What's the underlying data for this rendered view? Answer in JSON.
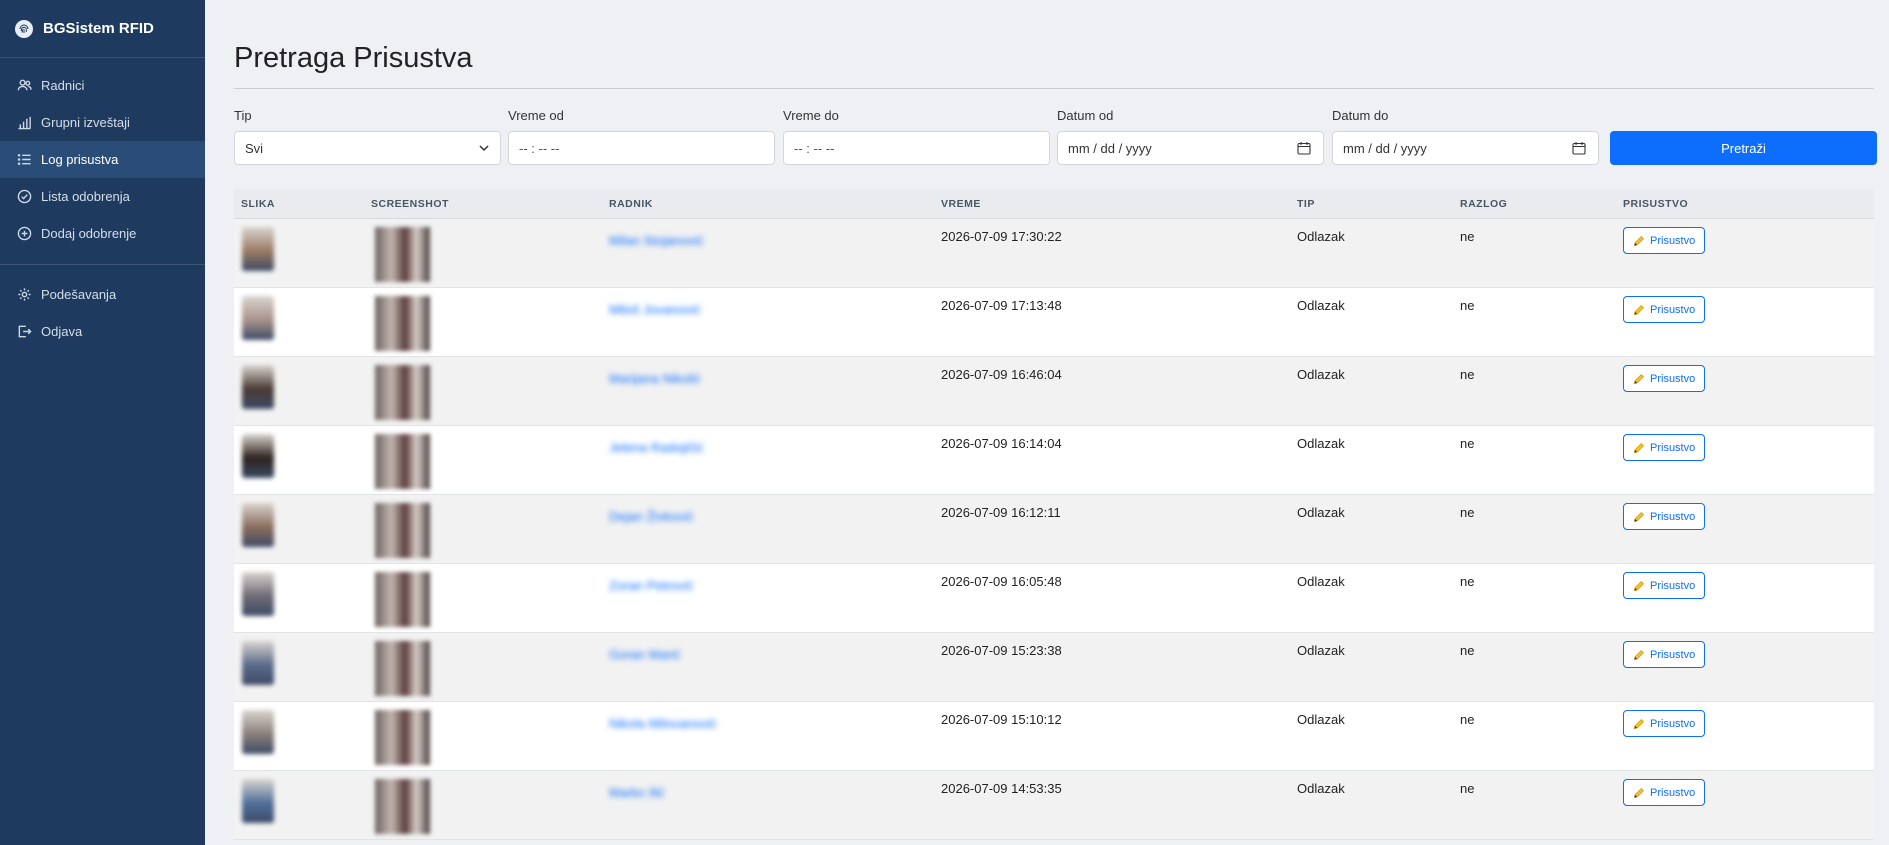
{
  "sidebar": {
    "brand": "BGSistem RFID",
    "items": [
      {
        "label": "Radnici",
        "icon": "users-icon"
      },
      {
        "label": "Grupni izveštaji",
        "icon": "bar-chart-icon"
      },
      {
        "label": "Log prisustva",
        "icon": "list-icon",
        "active": true
      },
      {
        "label": "Lista odobrenja",
        "icon": "check-circle-icon"
      },
      {
        "label": "Dodaj odobrenje",
        "icon": "plus-circle-icon"
      }
    ],
    "bottom_items": [
      {
        "label": "Podešavanja",
        "icon": "gear-icon"
      },
      {
        "label": "Odjava",
        "icon": "logout-icon"
      }
    ]
  },
  "page": {
    "title": "Pretraga Prisustva"
  },
  "filters": {
    "tip_label": "Tip",
    "tip_value": "Svi",
    "vreme_od_label": "Vreme od",
    "vreme_od_placeholder": "-- : --   --",
    "vreme_do_label": "Vreme do",
    "vreme_do_placeholder": "-- : --   --",
    "datum_od_label": "Datum od",
    "datum_od_placeholder": "mm / dd / yyyy",
    "datum_do_label": "Datum do",
    "datum_do_placeholder": "mm / dd / yyyy",
    "search_button": "Pretraži"
  },
  "table": {
    "columns": [
      "SLIKA",
      "SCREENSHOT",
      "RADNIK",
      "VREME",
      "TIP",
      "RAZLOG",
      "PRISUSTVO"
    ],
    "action_label": "Prisustvo",
    "rows": [
      {
        "radnik": "Milan Stojanović",
        "vreme": "2026-07-09 17:30:22",
        "tip": "Odlazak",
        "razlog": "ne"
      },
      {
        "radnik": "Miloš Jovanović",
        "vreme": "2026-07-09 17:13:48",
        "tip": "Odlazak",
        "razlog": "ne"
      },
      {
        "radnik": "Marijana Nikolić",
        "vreme": "2026-07-09 16:46:04",
        "tip": "Odlazak",
        "razlog": "ne"
      },
      {
        "radnik": "Jelena Radojičić",
        "vreme": "2026-07-09 16:14:04",
        "tip": "Odlazak",
        "razlog": "ne"
      },
      {
        "radnik": "Dejan Živković",
        "vreme": "2026-07-09 16:12:11",
        "tip": "Odlazak",
        "razlog": "ne"
      },
      {
        "radnik": "Zoran Petrović",
        "vreme": "2026-07-09 16:05:48",
        "tip": "Odlazak",
        "razlog": "ne"
      },
      {
        "radnik": "Goran Marić",
        "vreme": "2026-07-09 15:23:38",
        "tip": "Odlazak",
        "razlog": "ne"
      },
      {
        "radnik": "Nikola Milovanović",
        "vreme": "2026-07-09 15:10:12",
        "tip": "Odlazak",
        "razlog": "ne"
      },
      {
        "radnik": "Marko Ilić",
        "vreme": "2026-07-09 14:53:35",
        "tip": "Odlazak",
        "razlog": "ne"
      }
    ]
  },
  "colors": {
    "sidebar_bg": "#1e3a5f",
    "sidebar_active": "#2a4d78",
    "accent": "#0d6efd",
    "page_bg": "#eef0f4"
  }
}
